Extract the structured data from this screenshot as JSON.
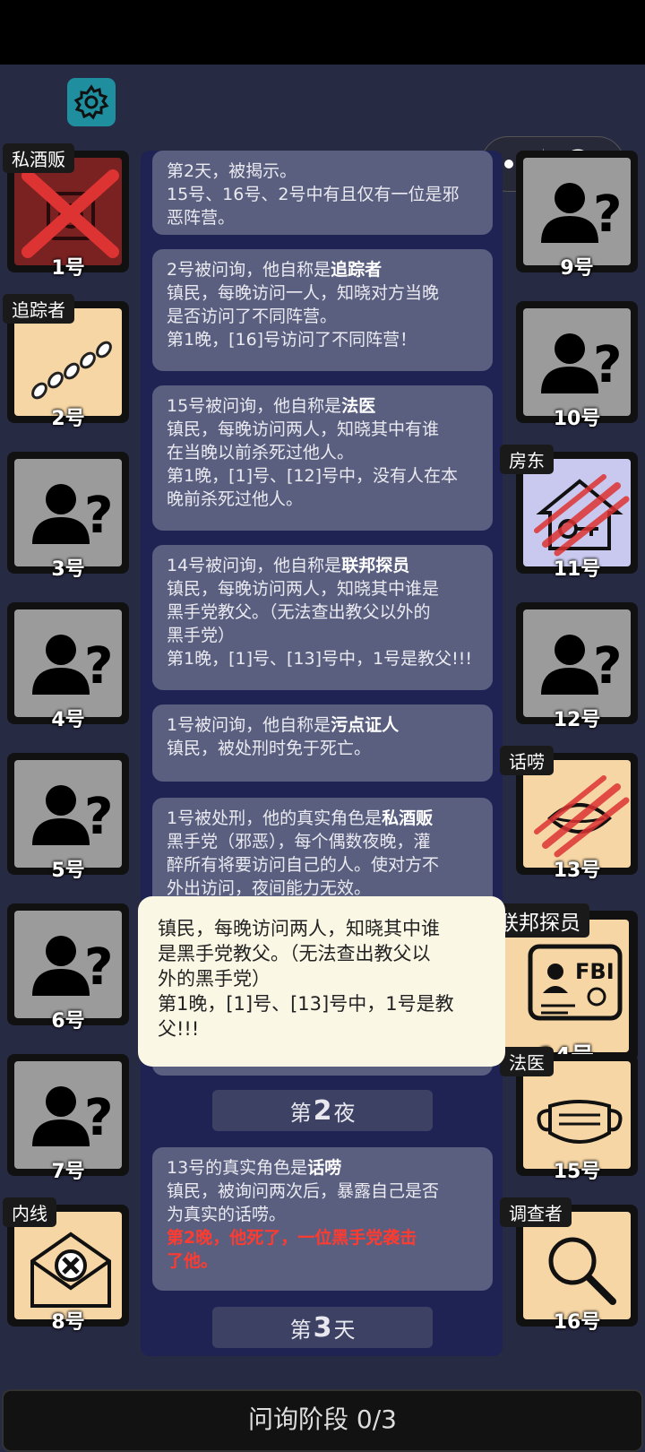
{
  "players": [
    {
      "num": "1号",
      "role_tag": "私酒贩"
    },
    {
      "num": "2号",
      "role_tag": "追踪者"
    },
    {
      "num": "3号"
    },
    {
      "num": "4号"
    },
    {
      "num": "5号"
    },
    {
      "num": "6号"
    },
    {
      "num": "7号"
    },
    {
      "num": "8号",
      "role_tag": "内线"
    },
    {
      "num": "9号"
    },
    {
      "num": "10号"
    },
    {
      "num": "11号",
      "role_tag": "房东"
    },
    {
      "num": "12号"
    },
    {
      "num": "13号",
      "role_tag": "话唠"
    },
    {
      "num": "14号",
      "role_tag": "联邦探员"
    },
    {
      "num": "15号",
      "role_tag": "法医"
    },
    {
      "num": "16号",
      "role_tag": "调查者"
    }
  ],
  "log": {
    "card1": {
      "l1": "第2天，被揭示。",
      "l2": "15号、16号、2号中有且仅有一位是邪",
      "l3": "恶阵营。"
    },
    "card2": {
      "p1": "2号被问询，他自称是",
      "role": "追踪者",
      "l2": "镇民，每晚访问一人，知晓对方当晚",
      "l3": "是否访问了不同阵营。",
      "l4": "第1晚，[16]号访问了不同阵营！"
    },
    "card3": {
      "p1": "15号被问询，他自称是",
      "role": "法医",
      "l2": "镇民，每晚访问两人，知晓其中有谁",
      "l3": "在当晚以前杀死过他人。",
      "l4": "第1晚，[1]号、[12]号中，没有人在本",
      "l5": "晚前杀死过他人。"
    },
    "card4": {
      "p1": "14号被问询，他自称是",
      "role": "联邦探员",
      "l2": "镇民，每晚访问两人，知晓其中谁是",
      "l3": "黑手党教父。（无法查出教父以外的",
      "l4": "黑手党）",
      "l5": "第1晚，[1]号、[13]号中，1号是教父!!!"
    },
    "card5": {
      "p1": "1号被问询，他自称是",
      "role": "污点证人",
      "l2": "镇民，被处刑时免于死亡。"
    },
    "card6": {
      "p1": "1号被处刑，他的真实角色是",
      "role": "私酒贩",
      "l2": "黑手党（邪恶），每个偶数夜晚，灌",
      "l3": "醉所有将要访问自己的人。使对方不",
      "l4": "外出访问，夜间能力无效。"
    },
    "night2": {
      "pre": "第",
      "n": "2",
      "post": "夜"
    },
    "card7": {
      "p1": "13号的真实角色是",
      "role": "话唠",
      "l2": "镇民，被询问两次后，暴露自己是否",
      "l3": "为真实的话唠。",
      "r1": "第2晚，他死了，一位黑手党袭击",
      "r2": "了他。"
    },
    "day3": {
      "pre": "第",
      "n": "3",
      "post": "天"
    }
  },
  "tooltip": {
    "l1": "镇民，每晚访问两人，知晓其中谁",
    "l2": "是黑手党教父。（无法查出教父以",
    "l3": "外的黑手党）",
    "l4": "第1晚，[1]号、[13]号中，1号是教",
    "l5": "父!!!"
  },
  "phase": "问询阶段 0/3",
  "icons": {
    "settings": "gear-icon",
    "more": "more-dots-icon",
    "close": "record-circle-icon"
  },
  "colors": {
    "unknown_bg": "#9b9b9b",
    "beige_bg": "#f6d6a4",
    "crossed_bg": "#7a2222",
    "landlord_bg": "#c9c9ef",
    "accent_red": "#ff3b30"
  }
}
